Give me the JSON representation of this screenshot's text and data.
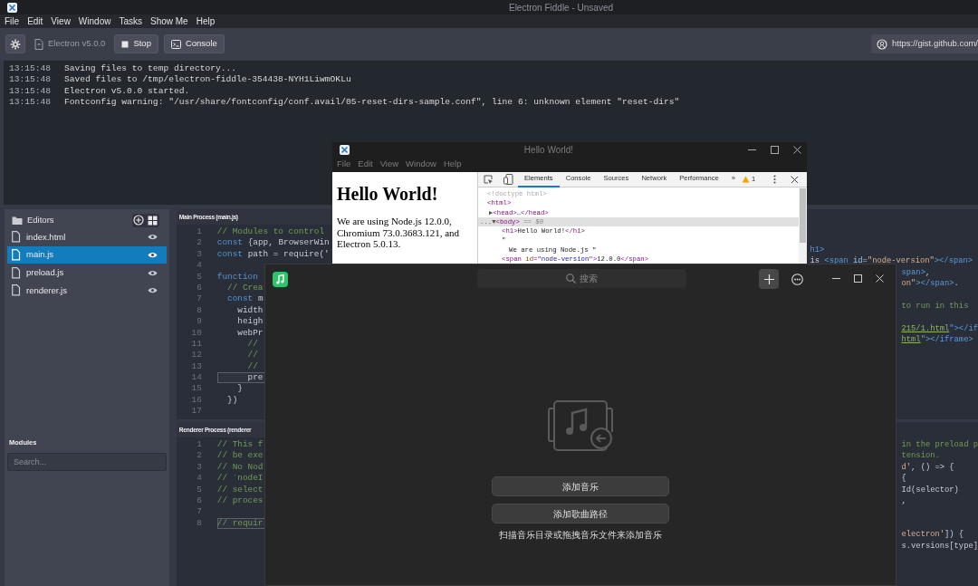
{
  "fiddle": {
    "title": "Electron Fiddle - Unsaved",
    "menu": [
      "File",
      "Edit",
      "View",
      "Window",
      "Tasks",
      "Show Me",
      "Help"
    ],
    "toolbar": {
      "version": "Electron v5.0.0",
      "buttons": [
        {
          "label": "Stop",
          "kind": "stop"
        },
        {
          "label": "Console",
          "kind": "console"
        }
      ],
      "gist_url": "https://gist.github.com/"
    }
  },
  "console": [
    {
      "time": "13:15:48",
      "message": "Saving files to temp directory..."
    },
    {
      "time": "13:15:48",
      "message": "Saved files to /tmp/electron-fiddle-354438-NYH1LiwmOKLu"
    },
    {
      "time": "13:15:48",
      "message": "Electron v5.0.0 started."
    },
    {
      "time": "13:15:48",
      "message": "Fontconfig warning: \"/usr/share/fontconfig/conf.avail/05-reset-dirs-sample.conf\", line 6: unknown element \"reset-dirs\""
    }
  ],
  "sidebar": {
    "title": "Editors",
    "files": [
      {
        "name": "index.html",
        "selected": false
      },
      {
        "name": "main.js",
        "selected": true
      },
      {
        "name": "preload.js",
        "selected": false
      },
      {
        "name": "renderer.js",
        "selected": false
      }
    ],
    "modules_title": "Modules",
    "search_placeholder": "Search..."
  },
  "editors": [
    {
      "title": "Main Process (main.js)",
      "lines": [
        {
          "number": "1",
          "active": false,
          "segments": [
            {
              "text": "// Modules to control",
              "kind": "comment"
            }
          ]
        },
        {
          "number": "2",
          "active": false,
          "segments": [
            {
              "text": "const",
              "kind": "keyword"
            },
            {
              "text": " {app, BrowserWin",
              "kind": "plain"
            }
          ]
        },
        {
          "number": "3",
          "active": false,
          "segments": [
            {
              "text": "const",
              "kind": "keyword"
            },
            {
              "text": " path = require('",
              "kind": "plain"
            }
          ]
        },
        {
          "number": "4",
          "active": false
        },
        {
          "number": "5",
          "active": false,
          "segments": [
            {
              "text": "function",
              "kind": "keyword"
            }
          ]
        },
        {
          "number": "6",
          "active": false,
          "segments": [
            {
              "text": "  // Crea",
              "kind": "comment"
            }
          ]
        },
        {
          "number": "7",
          "active": false,
          "segments": [
            {
              "text": "  const",
              "kind": "keyword"
            },
            {
              "text": " m",
              "kind": "plain"
            }
          ]
        },
        {
          "number": "8",
          "active": false,
          "segments": [
            {
              "text": "    width",
              "kind": "plain"
            }
          ]
        },
        {
          "number": "9",
          "active": false,
          "segments": [
            {
              "text": "    heigh",
              "kind": "plain"
            }
          ]
        },
        {
          "number": "10",
          "active": false,
          "segments": [
            {
              "text": "    webPr",
              "kind": "plain"
            }
          ]
        },
        {
          "number": "11",
          "active": false,
          "segments": [
            {
              "text": "      //",
              "kind": "comment"
            }
          ]
        },
        {
          "number": "12",
          "active": false,
          "segments": [
            {
              "text": "      //",
              "kind": "comment"
            }
          ]
        },
        {
          "number": "13",
          "active": false,
          "segments": [
            {
              "text": "      //",
              "kind": "comment"
            }
          ]
        },
        {
          "number": "14",
          "active": true,
          "segments": [
            {
              "text": "      pre",
              "kind": "plain"
            }
          ]
        },
        {
          "number": "15",
          "active": false,
          "segments": [
            {
              "text": "    }",
              "kind": "plain"
            }
          ]
        },
        {
          "number": "16",
          "active": false,
          "segments": [
            {
              "text": "  })",
              "kind": "plain"
            }
          ]
        },
        {
          "number": "17",
          "active": false
        }
      ]
    },
    {
      "title": "Renderer Process (renderer",
      "lines": [
        {
          "number": "1",
          "active": false,
          "segments": [
            {
              "text": "// This f",
              "kind": "comment"
            }
          ]
        },
        {
          "number": "2",
          "active": false,
          "segments": [
            {
              "text": "// be exe",
              "kind": "comment"
            }
          ]
        },
        {
          "number": "3",
          "active": false,
          "segments": [
            {
              "text": "// No Nod",
              "kind": "comment"
            }
          ]
        },
        {
          "number": "4",
          "active": false,
          "segments": [
            {
              "text": "// `nodeI",
              "kind": "comment"
            }
          ]
        },
        {
          "number": "5",
          "active": false,
          "segments": [
            {
              "text": "// select",
              "kind": "comment"
            }
          ]
        },
        {
          "number": "6",
          "active": false,
          "segments": [
            {
              "text": "// proces",
              "kind": "comment"
            }
          ]
        },
        {
          "number": "7",
          "active": false
        },
        {
          "number": "8",
          "active": true,
          "segments": [
            {
              "text": "// requir",
              "kind": "comment"
            }
          ]
        }
      ]
    }
  ],
  "hidden_panes": [
    {
      "kind": "html",
      "blocks": [
        [
          {
            "kind": "beside_devtools",
            "segments": [
              {
                "text": "h1>",
                "kind": "tag"
              }
            ]
          },
          {
            "kind": "beside_devtools",
            "segments": [
              {
                "text": "is ",
                "kind": "plain"
              },
              {
                "text": "<span ",
                "kind": "tag"
              },
              {
                "text": "id=",
                "kind": "attr"
              },
              {
                "text": "\"node-version\"",
                "kind": "string"
              },
              {
                "text": "></span>",
                "kind": "tag"
              }
            ]
          },
          {
            "kind": "beside_player",
            "segments": [
              {
                "text": "span>",
                "kind": "tag"
              },
              {
                "text": ",",
                "kind": "plain"
              }
            ]
          },
          {
            "kind": "beside_player",
            "segments": [
              {
                "text": "on\"",
                "kind": "string"
              },
              {
                "text": "></span>",
                "kind": "tag"
              },
              {
                "text": ".",
                "kind": "plain"
              }
            ]
          }
        ],
        [
          {
            "kind": "beside_player",
            "segments": [
              {
                "text": "to run in this",
                "kind": "comment"
              }
            ]
          }
        ],
        [
          {
            "kind": "beside_player",
            "segments": [
              {
                "text": "215/1.html",
                "kind": "url"
              },
              {
                "text": "\"></if",
                "kind": "tag"
              }
            ]
          },
          {
            "kind": "beside_player",
            "segments": [
              {
                "text": "html",
                "kind": "url"
              },
              {
                "text": "\"></iframe>",
                "kind": "tag"
              }
            ]
          }
        ]
      ]
    },
    {
      "kind": "preload",
      "blocks": [
        [
          {
            "kind": "beside_player",
            "segments": [
              {
                "text": "in the preload p",
                "kind": "comment"
              }
            ]
          },
          {
            "kind": "beside_player",
            "segments": [
              {
                "text": "tension.",
                "kind": "comment"
              }
            ]
          },
          {
            "kind": "beside_player",
            "segments": [
              {
                "text": "d'",
                "kind": "string"
              },
              {
                "text": ", () => {",
                "kind": "plain"
              }
            ]
          },
          {
            "kind": "beside_player",
            "segments": [
              {
                "text": "{",
                "kind": "plain"
              }
            ]
          },
          {
            "kind": "beside_player",
            "segments": [
              {
                "text": "Id(selector)",
                "kind": "plain"
              }
            ]
          },
          {
            "kind": "beside_player",
            "segments": [
              {
                "text": ",",
                "kind": "plain"
              }
            ]
          }
        ],
        [
          {
            "kind": "beside_player",
            "segments": [
              {
                "text": "electron'",
                "kind": "string"
              },
              {
                "text": "]) {",
                "kind": "plain"
              }
            ]
          },
          {
            "kind": "beside_player",
            "segments": [
              {
                "text": "s.versions[type]",
                "kind": "plain"
              }
            ]
          }
        ]
      ]
    }
  ],
  "hello_window": {
    "title": "Hello World!",
    "menu": [
      "File",
      "Edit",
      "View",
      "Window",
      "Help"
    ],
    "heading": "Hello World!",
    "paragraph": "We are using Node.js 12.0.0, Chromium 73.0.3683.121, and Electron 5.0.13.",
    "devtools": {
      "tabs": [
        {
          "label": "Elements",
          "selected": true
        },
        {
          "label": "Console",
          "selected": false
        },
        {
          "label": "Sources",
          "selected": false
        },
        {
          "label": "Network",
          "selected": false
        },
        {
          "label": "Performance",
          "selected": false
        }
      ],
      "more": "»",
      "warnings": "1",
      "dom": [
        {
          "selected": false,
          "segments": [
            {
              "text": "<!doctype html>",
              "kind": "doctype"
            }
          ]
        },
        {
          "selected": false,
          "segments": [
            {
              "text": "<html>",
              "kind": "tag"
            }
          ],
          "children": [
            {
              "selected": false,
              "toggle": "▶",
              "segments": [
                {
                  "text": "<head>",
                  "kind": "tag"
                },
                {
                  "text": "…",
                  "kind": "text"
                },
                {
                  "text": "</head>",
                  "kind": "tag"
                }
              ]
            },
            {
              "selected": true,
              "prefix": "...",
              "toggle": "▼",
              "segments": [
                {
                  "text": "<body>",
                  "kind": "tag"
                },
                {
                  "text": " == $0",
                  "kind": "hint"
                }
              ],
              "children": [
                {
                  "selected": false,
                  "segments": [
                    {
                      "text": "<h1>",
                      "kind": "tag"
                    },
                    {
                      "text": "Hello World!",
                      "kind": "text"
                    },
                    {
                      "text": "</h1>",
                      "kind": "tag"
                    }
                  ]
                },
                {
                  "selected": false,
                  "segments": [
                    {
                      "text": "\"",
                      "kind": "text"
                    }
                  ],
                  "children": [
                    {
                      "selected": false,
                      "segments": [
                        {
                          "text": "We are using Node.js \"",
                          "kind": "text"
                        }
                      ]
                    }
                  ]
                },
                {
                  "selected": false,
                  "segments": [
                    {
                      "text": "<span ",
                      "kind": "tag"
                    },
                    {
                      "text": "id",
                      "kind": "attr"
                    },
                    {
                      "text": "=\"",
                      "kind": "tag"
                    },
                    {
                      "text": "node-version",
                      "kind": "attrval"
                    },
                    {
                      "text": "\">",
                      "kind": "tag"
                    },
                    {
                      "text": "12.0.0",
                      "kind": "text"
                    },
                    {
                      "text": "</span>",
                      "kind": "tag"
                    }
                  ]
                }
              ]
            }
          ]
        }
      ]
    }
  },
  "player": {
    "search_placeholder": "搜索",
    "buttons": [
      "添加音乐",
      "添加歌曲路径"
    ],
    "hint_link": "扫描",
    "hint": "音乐目录或拖拽音乐文件来添加音乐"
  }
}
